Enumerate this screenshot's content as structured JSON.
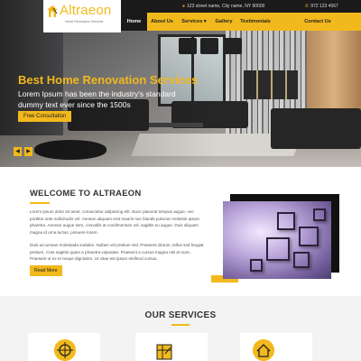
{
  "header": {
    "logo_name": "Altraeon",
    "logo_tagline": "Home Renovation Services",
    "address": "123 street name, City name, NY 90000",
    "phone": "972 123 4567",
    "nav": [
      "Home",
      "About Us",
      "Services ▾",
      "Gallery",
      "Testimonials",
      "Contact Us"
    ],
    "active_index": 0
  },
  "hero": {
    "title": "Best Home Renovation Services",
    "text": "Lorem Ipsum has been the industry's standard dummy text ever since the 1500s",
    "button": "Free Consultation",
    "prev": "◀",
    "next": "▶"
  },
  "welcome": {
    "title": "WELCOME TO ALTRAEON",
    "p1": "Lorem ipsum dolor sit amet, consectetur adipiscing elit. Nunc placerat tempus augue, nec porttitor ante sollicitudin vel. Aenean aliquam erat mauris nec blandit pulvinar molestie ipsum pharetra. Aenean augue sem, convallis at condimentum vel, sagittis eu augue. Duis aliquam magna id urna luctus, posuere lorem.",
    "p2": "Duis accumsan molestada sodales. Nullam vel pretium nisl. Praesent dictum, tellus sed feugiat pretium. Cras sagittis quam a pharetra vulputate. Praesent a cursus magna nisl et nunc. Praesent ut ex et neque dignissim. Ut vitae est ipsum eleifend cursus.",
    "button": "Read More"
  },
  "services": {
    "title": "OUR SERVICES",
    "icons": [
      "compass-icon",
      "blueprint-icon",
      "house-icon"
    ]
  },
  "colors": {
    "accent": "#f2b91c",
    "dark": "#1a1a1a"
  }
}
